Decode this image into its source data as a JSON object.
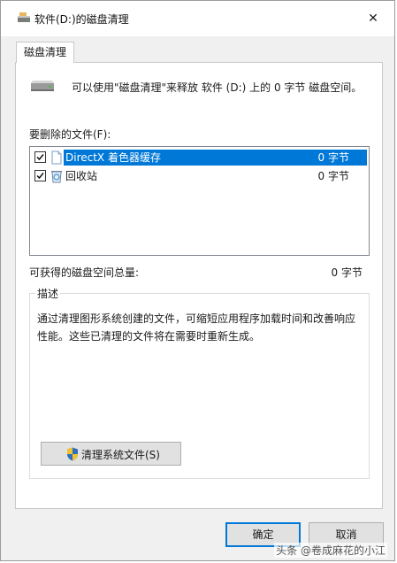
{
  "window": {
    "title": "软件(D:)的磁盘清理",
    "close_glyph": "✕"
  },
  "tab": {
    "label": "磁盘清理"
  },
  "intro": {
    "text": "可以使用\"磁盘清理\"来释放 软件 (D:) 上的 0 字节 磁盘空间。"
  },
  "files": {
    "label": "要删除的文件(F):",
    "items": [
      {
        "name": "DirectX 着色器缓存",
        "size": "0 字节",
        "checked": true,
        "selected": true,
        "icon": "file-icon"
      },
      {
        "name": "回收站",
        "size": "0 字节",
        "checked": true,
        "selected": false,
        "icon": "recycle-bin-icon"
      }
    ]
  },
  "total": {
    "label": "可获得的磁盘空间总量:",
    "value": "0 字节"
  },
  "description": {
    "legend": "描述",
    "text": "通过清理图形系统创建的文件，可缩短应用程序加载时间和改善响应性能。这些已清理的文件将在需要时重新生成。"
  },
  "cleanup_button": {
    "label": "清理系统文件(S)",
    "icon": "shield-icon"
  },
  "buttons": {
    "ok": "确定",
    "cancel": "取消"
  },
  "watermark": "头条 @卷成麻花的小江",
  "colors": {
    "selection": "#0078d7",
    "accent": "#0078d7"
  }
}
